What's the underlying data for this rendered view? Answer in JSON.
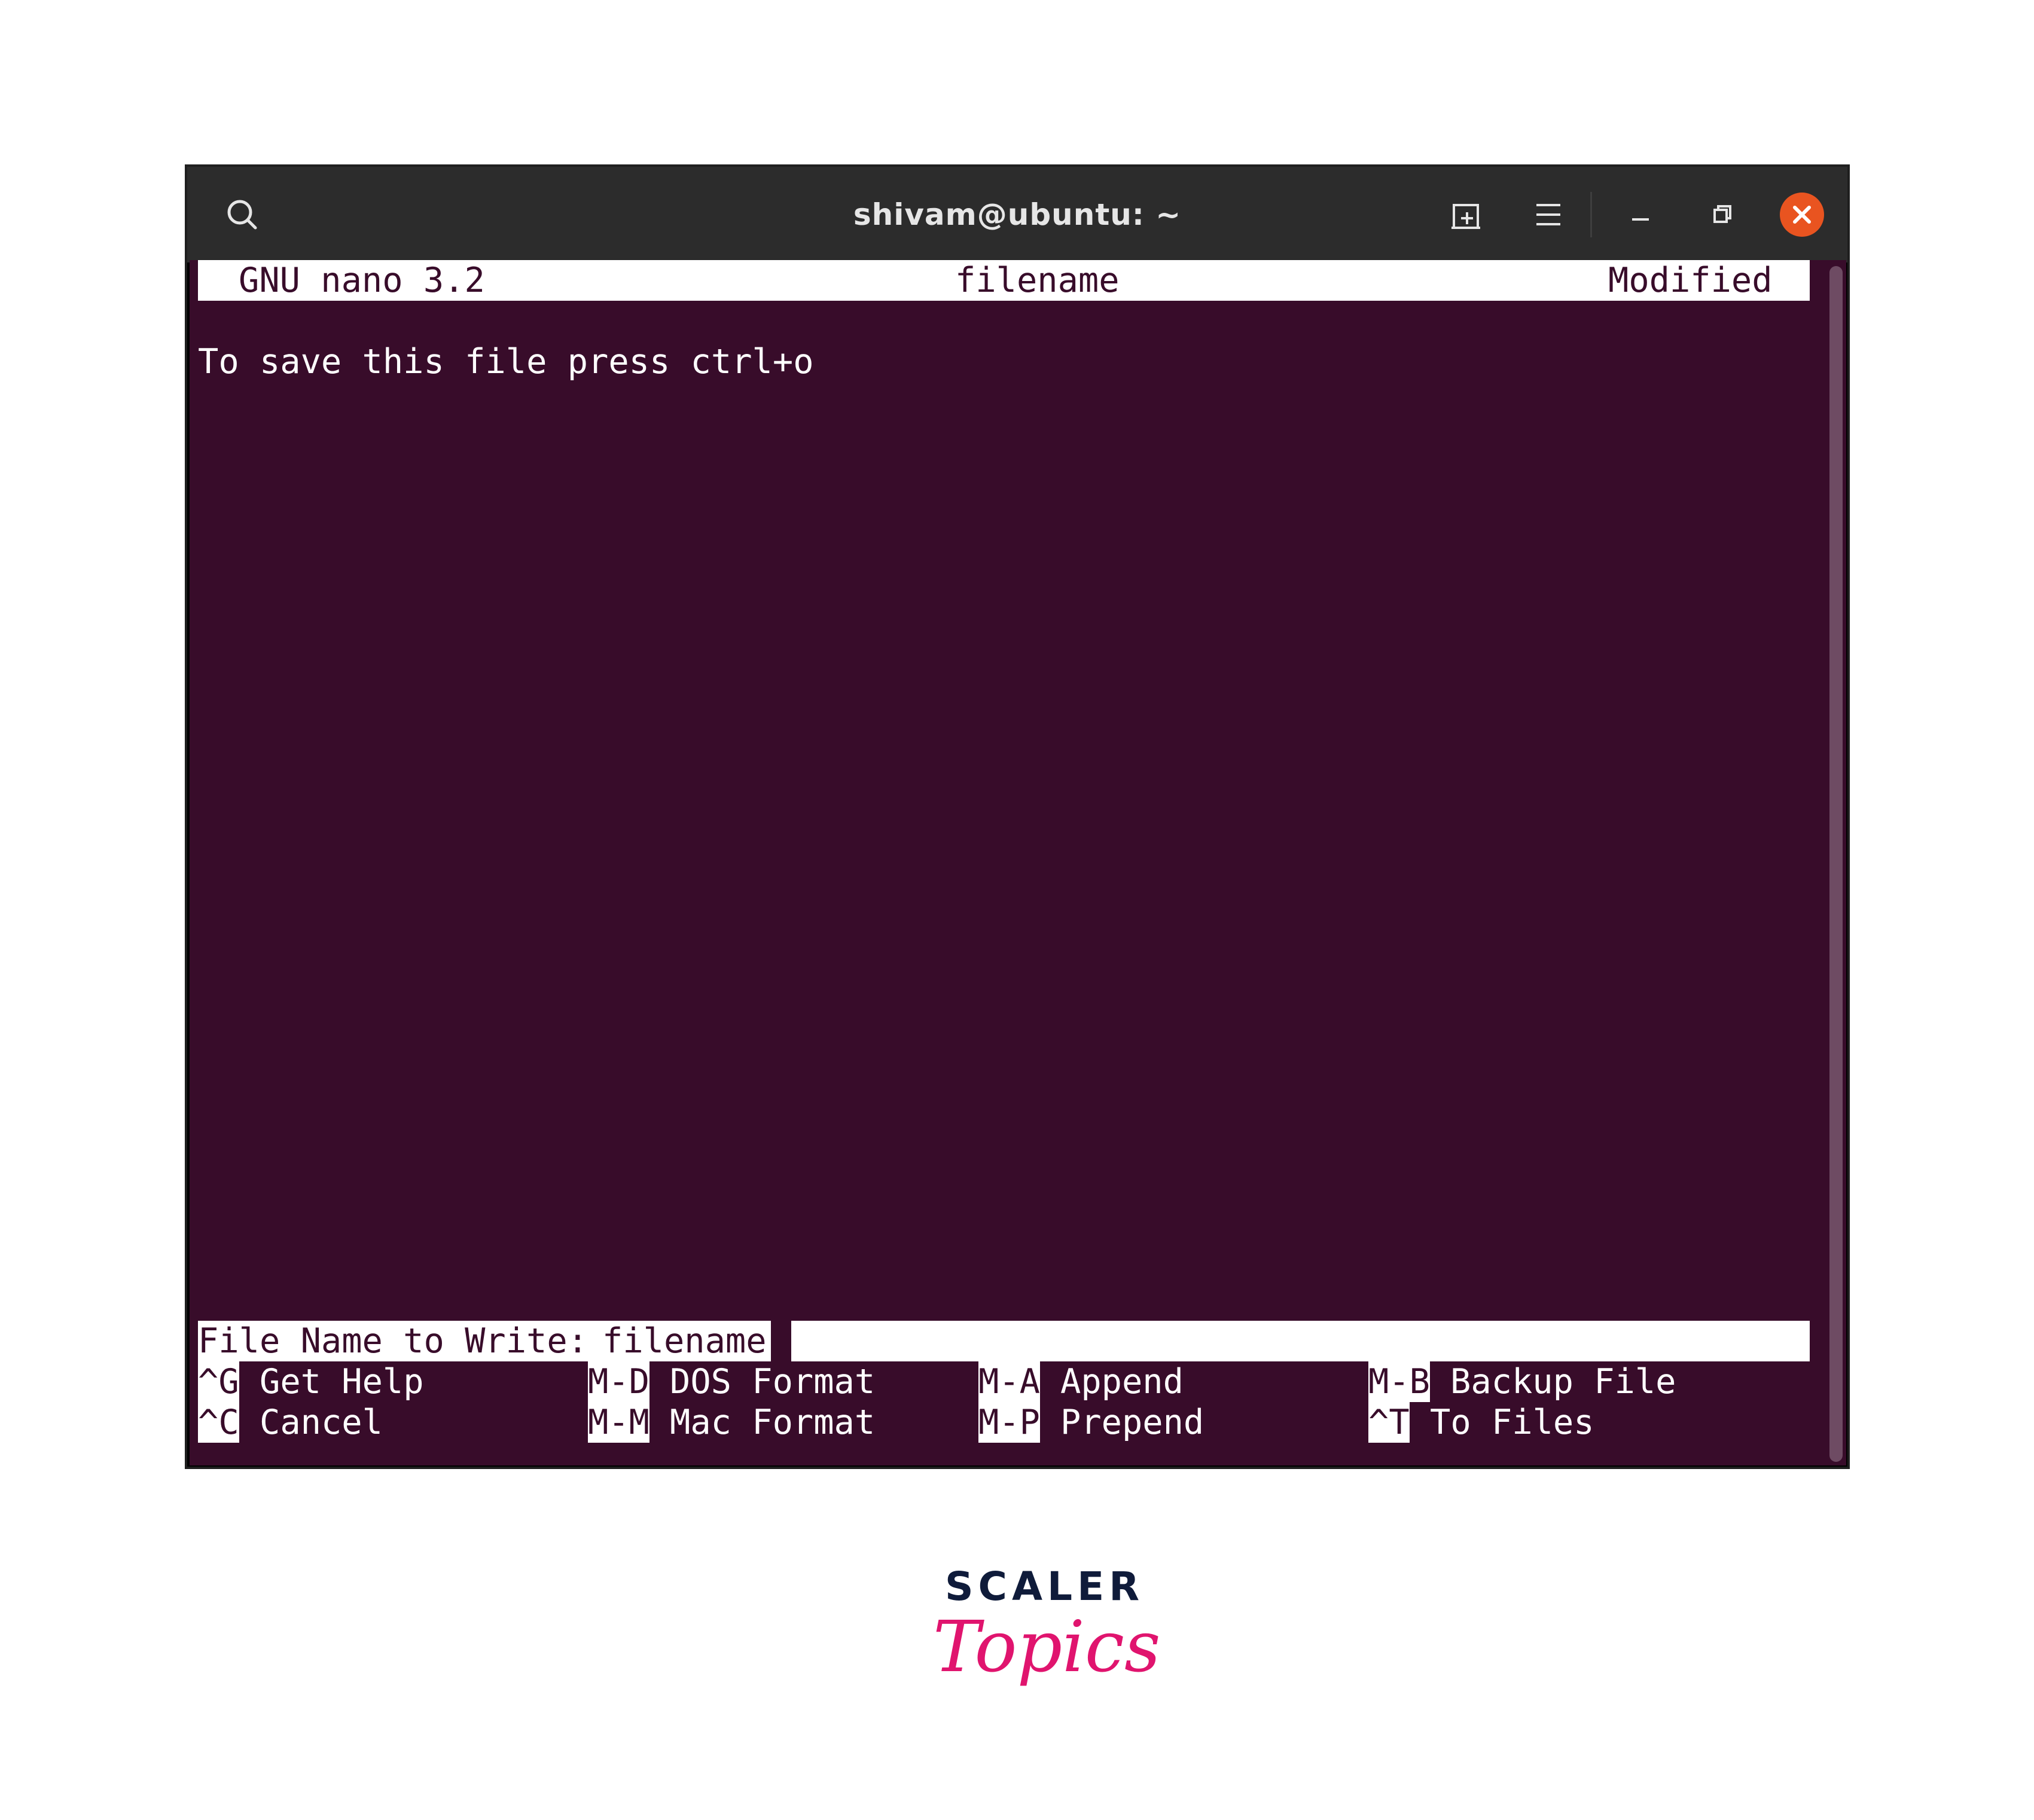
{
  "window": {
    "title": "shivam@ubuntu: ~",
    "icons": {
      "search": "search-icon",
      "new_tab": "new-tab-icon",
      "menu": "hamburger-menu-icon",
      "minimize": "minimize-icon",
      "restore": "restore-icon",
      "close": "close-icon"
    },
    "close_color": "#e95420"
  },
  "nano": {
    "header": {
      "version": "GNU nano 3.2",
      "filename": "filename",
      "status": "Modified"
    },
    "content_lines": [
      "To save this file press ctrl+o"
    ],
    "prompt": {
      "label": "File Name to Write: ",
      "value": "filename"
    },
    "shortcuts": [
      {
        "key": "^G",
        "label": "Get Help"
      },
      {
        "key": "M-D",
        "label": "DOS Format"
      },
      {
        "key": "M-A",
        "label": "Append"
      },
      {
        "key": "M-B",
        "label": "Backup File"
      },
      {
        "key": "^C",
        "label": "Cancel"
      },
      {
        "key": "M-M",
        "label": "Mac Format"
      },
      {
        "key": "M-P",
        "label": "Prepend"
      },
      {
        "key": "^T",
        "label": "To Files"
      }
    ],
    "colors": {
      "background": "#380c2a",
      "foreground": "#ffffff"
    }
  },
  "logo": {
    "line1": "SCALER",
    "line2": "Topics",
    "colors": {
      "line1": "#0f1b3a",
      "line2": "#e0146e"
    }
  }
}
